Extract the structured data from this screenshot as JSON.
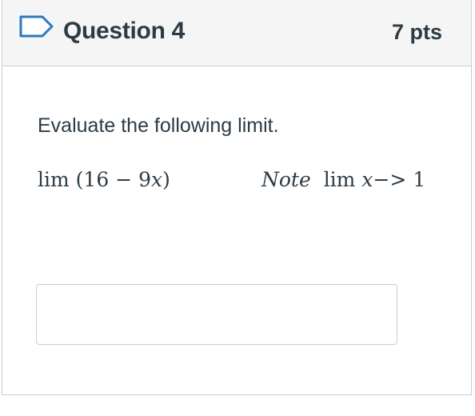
{
  "question": {
    "title": "Question 4",
    "points": "7 pts",
    "prompt": "Evaluate the following limit.",
    "expression": {
      "fn": "lim",
      "open": "(",
      "const": "16",
      "op": "−",
      "coef": "9",
      "var": "x",
      "close": ")"
    },
    "note": {
      "word": "Note",
      "fn": "lim",
      "var": "x",
      "arrow": "−>",
      "target": "1"
    },
    "answer_value": ""
  }
}
